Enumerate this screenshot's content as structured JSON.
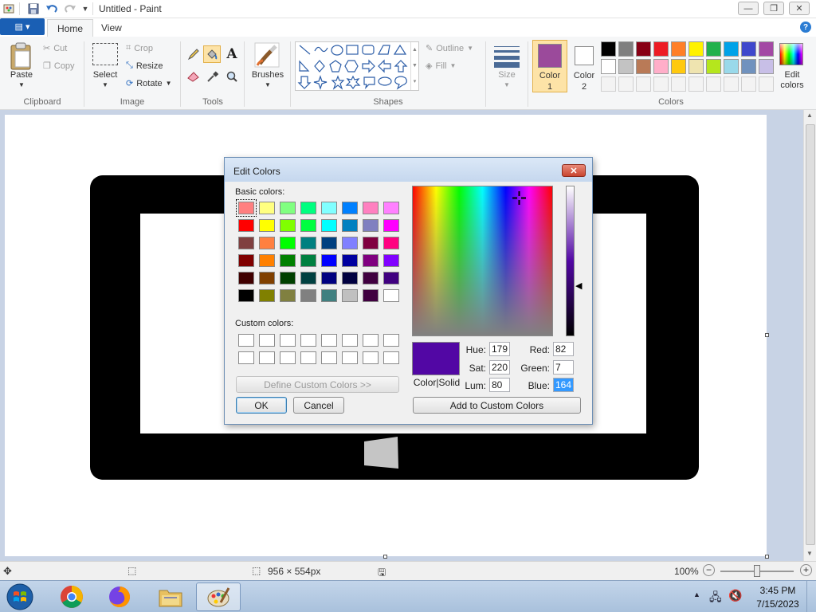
{
  "window": {
    "title": "Untitled - Paint",
    "minimize": "—",
    "maximize": "❐",
    "close": "✕"
  },
  "tabs": {
    "file": "▤ ▾",
    "home": "Home",
    "view": "View",
    "help": "?"
  },
  "ribbon": {
    "clipboard": {
      "paste": "Paste",
      "cut": "Cut",
      "copy": "Copy",
      "label": "Clipboard"
    },
    "image": {
      "select": "Select",
      "crop": "Crop",
      "resize": "Resize",
      "rotate": "Rotate",
      "label": "Image"
    },
    "tools": {
      "label": "Tools"
    },
    "brushes": {
      "label": "Brushes"
    },
    "shapes": {
      "outline": "Outline",
      "fill": "Fill",
      "label": "Shapes"
    },
    "size": {
      "label": "Size"
    },
    "color1": {
      "label": "Color",
      "num": "1",
      "value": "#9b4a9b"
    },
    "color2": {
      "label": "Color",
      "num": "2",
      "value": "#ffffff"
    },
    "colors_label": "Colors",
    "edit_colors": {
      "line1": "Edit",
      "line2": "colors"
    },
    "palette_row1": [
      "#000000",
      "#7f7f7f",
      "#880015",
      "#ed1c24",
      "#ff7f27",
      "#fff200",
      "#22b14c",
      "#00a2e8",
      "#3f48cc",
      "#a349a4"
    ],
    "palette_row2": [
      "#ffffff",
      "#c3c3c3",
      "#b97a57",
      "#ffaec9",
      "#ffc90e",
      "#efe4b0",
      "#b5e61d",
      "#99d9ea",
      "#7092be",
      "#c8bfe7"
    ]
  },
  "dialog": {
    "title": "Edit Colors",
    "close": "✕",
    "basic_colors_label": "Basic colors:",
    "basic_colors": [
      [
        "#ff8080",
        "#ffff80",
        "#80ff80",
        "#00ff80",
        "#80ffff",
        "#0080ff",
        "#ff80c0",
        "#ff80ff"
      ],
      [
        "#ff0000",
        "#ffff00",
        "#80ff00",
        "#00ff40",
        "#00ffff",
        "#0080c0",
        "#8080c0",
        "#ff00ff"
      ],
      [
        "#804040",
        "#ff8040",
        "#00ff00",
        "#008080",
        "#004080",
        "#8080ff",
        "#800040",
        "#ff0080"
      ],
      [
        "#800000",
        "#ff8000",
        "#008000",
        "#008040",
        "#0000ff",
        "#0000a0",
        "#800080",
        "#8000ff"
      ],
      [
        "#400000",
        "#804000",
        "#004000",
        "#004040",
        "#000080",
        "#000040",
        "#400040",
        "#400080"
      ],
      [
        "#000000",
        "#808000",
        "#808040",
        "#808080",
        "#408080",
        "#c0c0c0",
        "#400040",
        "#ffffff"
      ]
    ],
    "custom_colors_label": "Custom colors:",
    "define_custom": "Define Custom Colors >>",
    "ok": "OK",
    "cancel": "Cancel",
    "color_solid_label": "Color|Solid",
    "preview_color": "#5207a4",
    "hue_label": "Hue:",
    "hue": "179",
    "sat_label": "Sat:",
    "sat": "220",
    "lum_label": "Lum:",
    "lum": "80",
    "red_label": "Red:",
    "red": "82",
    "green_label": "Green:",
    "green": "7",
    "blue_label": "Blue:",
    "blue": "164",
    "add_custom": "Add to Custom Colors"
  },
  "statusbar": {
    "dimensions": "956 × 554px",
    "zoom": "100%"
  },
  "taskbar": {
    "time": "3:45 PM",
    "date": "7/15/2023"
  }
}
